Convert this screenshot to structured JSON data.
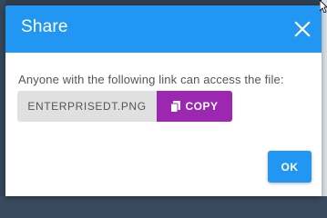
{
  "dialog": {
    "title": "Share",
    "message": "Anyone with the following link can access the file:",
    "filename": "ENTERPRISEDT.PNG",
    "copy_label": "COPY",
    "ok_label": "OK"
  },
  "colors": {
    "header": "#2196f3",
    "copy_button": "#9c27b0",
    "ok_button": "#2196f3",
    "filename_bg": "#e0e0e0"
  },
  "icons": {
    "close": "close-icon",
    "copy": "copy-icon",
    "cursor": "mouse-cursor-icon"
  }
}
